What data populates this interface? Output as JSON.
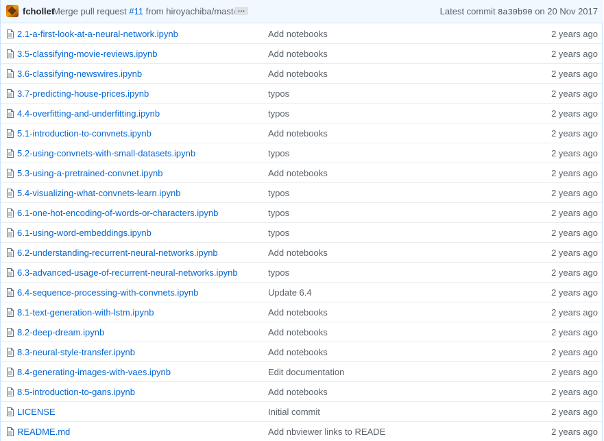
{
  "commit_bar": {
    "author": "fchollet",
    "message_prefix": "Merge pull request ",
    "pr_number": "#11",
    "message_suffix": " from hiroyachiba/master",
    "ellipsis": "…",
    "latest_label": "Latest commit ",
    "sha": "8a30b90",
    "date": " on 20 Nov 2017"
  },
  "files": [
    {
      "name": "2.1-a-first-look-at-a-neural-network.ipynb",
      "message": "Add notebooks",
      "age": "2 years ago"
    },
    {
      "name": "3.5-classifying-movie-reviews.ipynb",
      "message": "Add notebooks",
      "age": "2 years ago"
    },
    {
      "name": "3.6-classifying-newswires.ipynb",
      "message": "Add notebooks",
      "age": "2 years ago"
    },
    {
      "name": "3.7-predicting-house-prices.ipynb",
      "message": "typos",
      "age": "2 years ago"
    },
    {
      "name": "4.4-overfitting-and-underfitting.ipynb",
      "message": "typos",
      "age": "2 years ago"
    },
    {
      "name": "5.1-introduction-to-convnets.ipynb",
      "message": "Add notebooks",
      "age": "2 years ago"
    },
    {
      "name": "5.2-using-convnets-with-small-datasets.ipynb",
      "message": "typos",
      "age": "2 years ago"
    },
    {
      "name": "5.3-using-a-pretrained-convnet.ipynb",
      "message": "Add notebooks",
      "age": "2 years ago"
    },
    {
      "name": "5.4-visualizing-what-convnets-learn.ipynb",
      "message": "typos",
      "age": "2 years ago"
    },
    {
      "name": "6.1-one-hot-encoding-of-words-or-characters.ipynb",
      "message": "typos",
      "age": "2 years ago"
    },
    {
      "name": "6.1-using-word-embeddings.ipynb",
      "message": "typos",
      "age": "2 years ago"
    },
    {
      "name": "6.2-understanding-recurrent-neural-networks.ipynb",
      "message": "Add notebooks",
      "age": "2 years ago"
    },
    {
      "name": "6.3-advanced-usage-of-recurrent-neural-networks.ipynb",
      "message": "typos",
      "age": "2 years ago"
    },
    {
      "name": "6.4-sequence-processing-with-convnets.ipynb",
      "message": "Update 6.4",
      "age": "2 years ago"
    },
    {
      "name": "8.1-text-generation-with-lstm.ipynb",
      "message": "Add notebooks",
      "age": "2 years ago"
    },
    {
      "name": "8.2-deep-dream.ipynb",
      "message": "Add notebooks",
      "age": "2 years ago"
    },
    {
      "name": "8.3-neural-style-transfer.ipynb",
      "message": "Add notebooks",
      "age": "2 years ago"
    },
    {
      "name": "8.4-generating-images-with-vaes.ipynb",
      "message": "Edit documentation",
      "age": "2 years ago"
    },
    {
      "name": "8.5-introduction-to-gans.ipynb",
      "message": "Add notebooks",
      "age": "2 years ago"
    },
    {
      "name": "LICENSE",
      "message": "Initial commit",
      "age": "2 years ago"
    },
    {
      "name": "README.md",
      "message": "Add nbviewer links to READE",
      "age": "2 years ago"
    }
  ],
  "icons": {
    "file": "file-icon",
    "avatar": "avatar"
  },
  "colors": {
    "link": "#0366d6",
    "muted": "#586069",
    "commit_bar_bg": "#f1f8ff",
    "border": "#c8e1ff"
  }
}
